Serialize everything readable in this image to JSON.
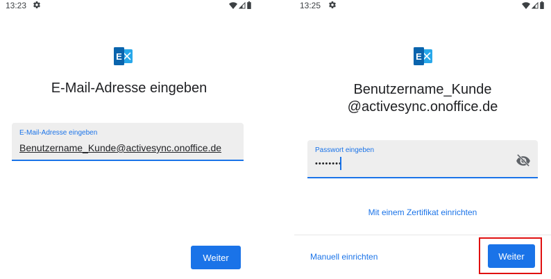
{
  "left_screen": {
    "status": {
      "time": "13:23"
    },
    "title": "E-Mail-Adresse eingeben",
    "email_field": {
      "label": "E-Mail-Adresse eingeben",
      "value": "Benutzername_Kunde@activesync.onoffice.de"
    },
    "next_label": "Weiter"
  },
  "right_screen": {
    "status": {
      "time": "13:25"
    },
    "title_line1": "Benutzername_Kunde",
    "title_line2": "@activesync.onoffice.de",
    "password_field": {
      "label": "Passwort eingeben",
      "value": "••••••••"
    },
    "certificate_link": "Mit einem Zertifikat einrichten",
    "manual_link": "Manuell einrichten",
    "next_label": "Weiter"
  },
  "colors": {
    "accent": "#1a73e8",
    "highlight": "#e01010",
    "exchange_blue": "#0a64ad"
  },
  "icons": {
    "settings": "gear-icon",
    "wifi": "wifi-icon",
    "signal": "cell-signal-icon",
    "battery": "battery-icon",
    "logo": "exchange-logo-icon",
    "visibility": "visibility-off-icon"
  }
}
